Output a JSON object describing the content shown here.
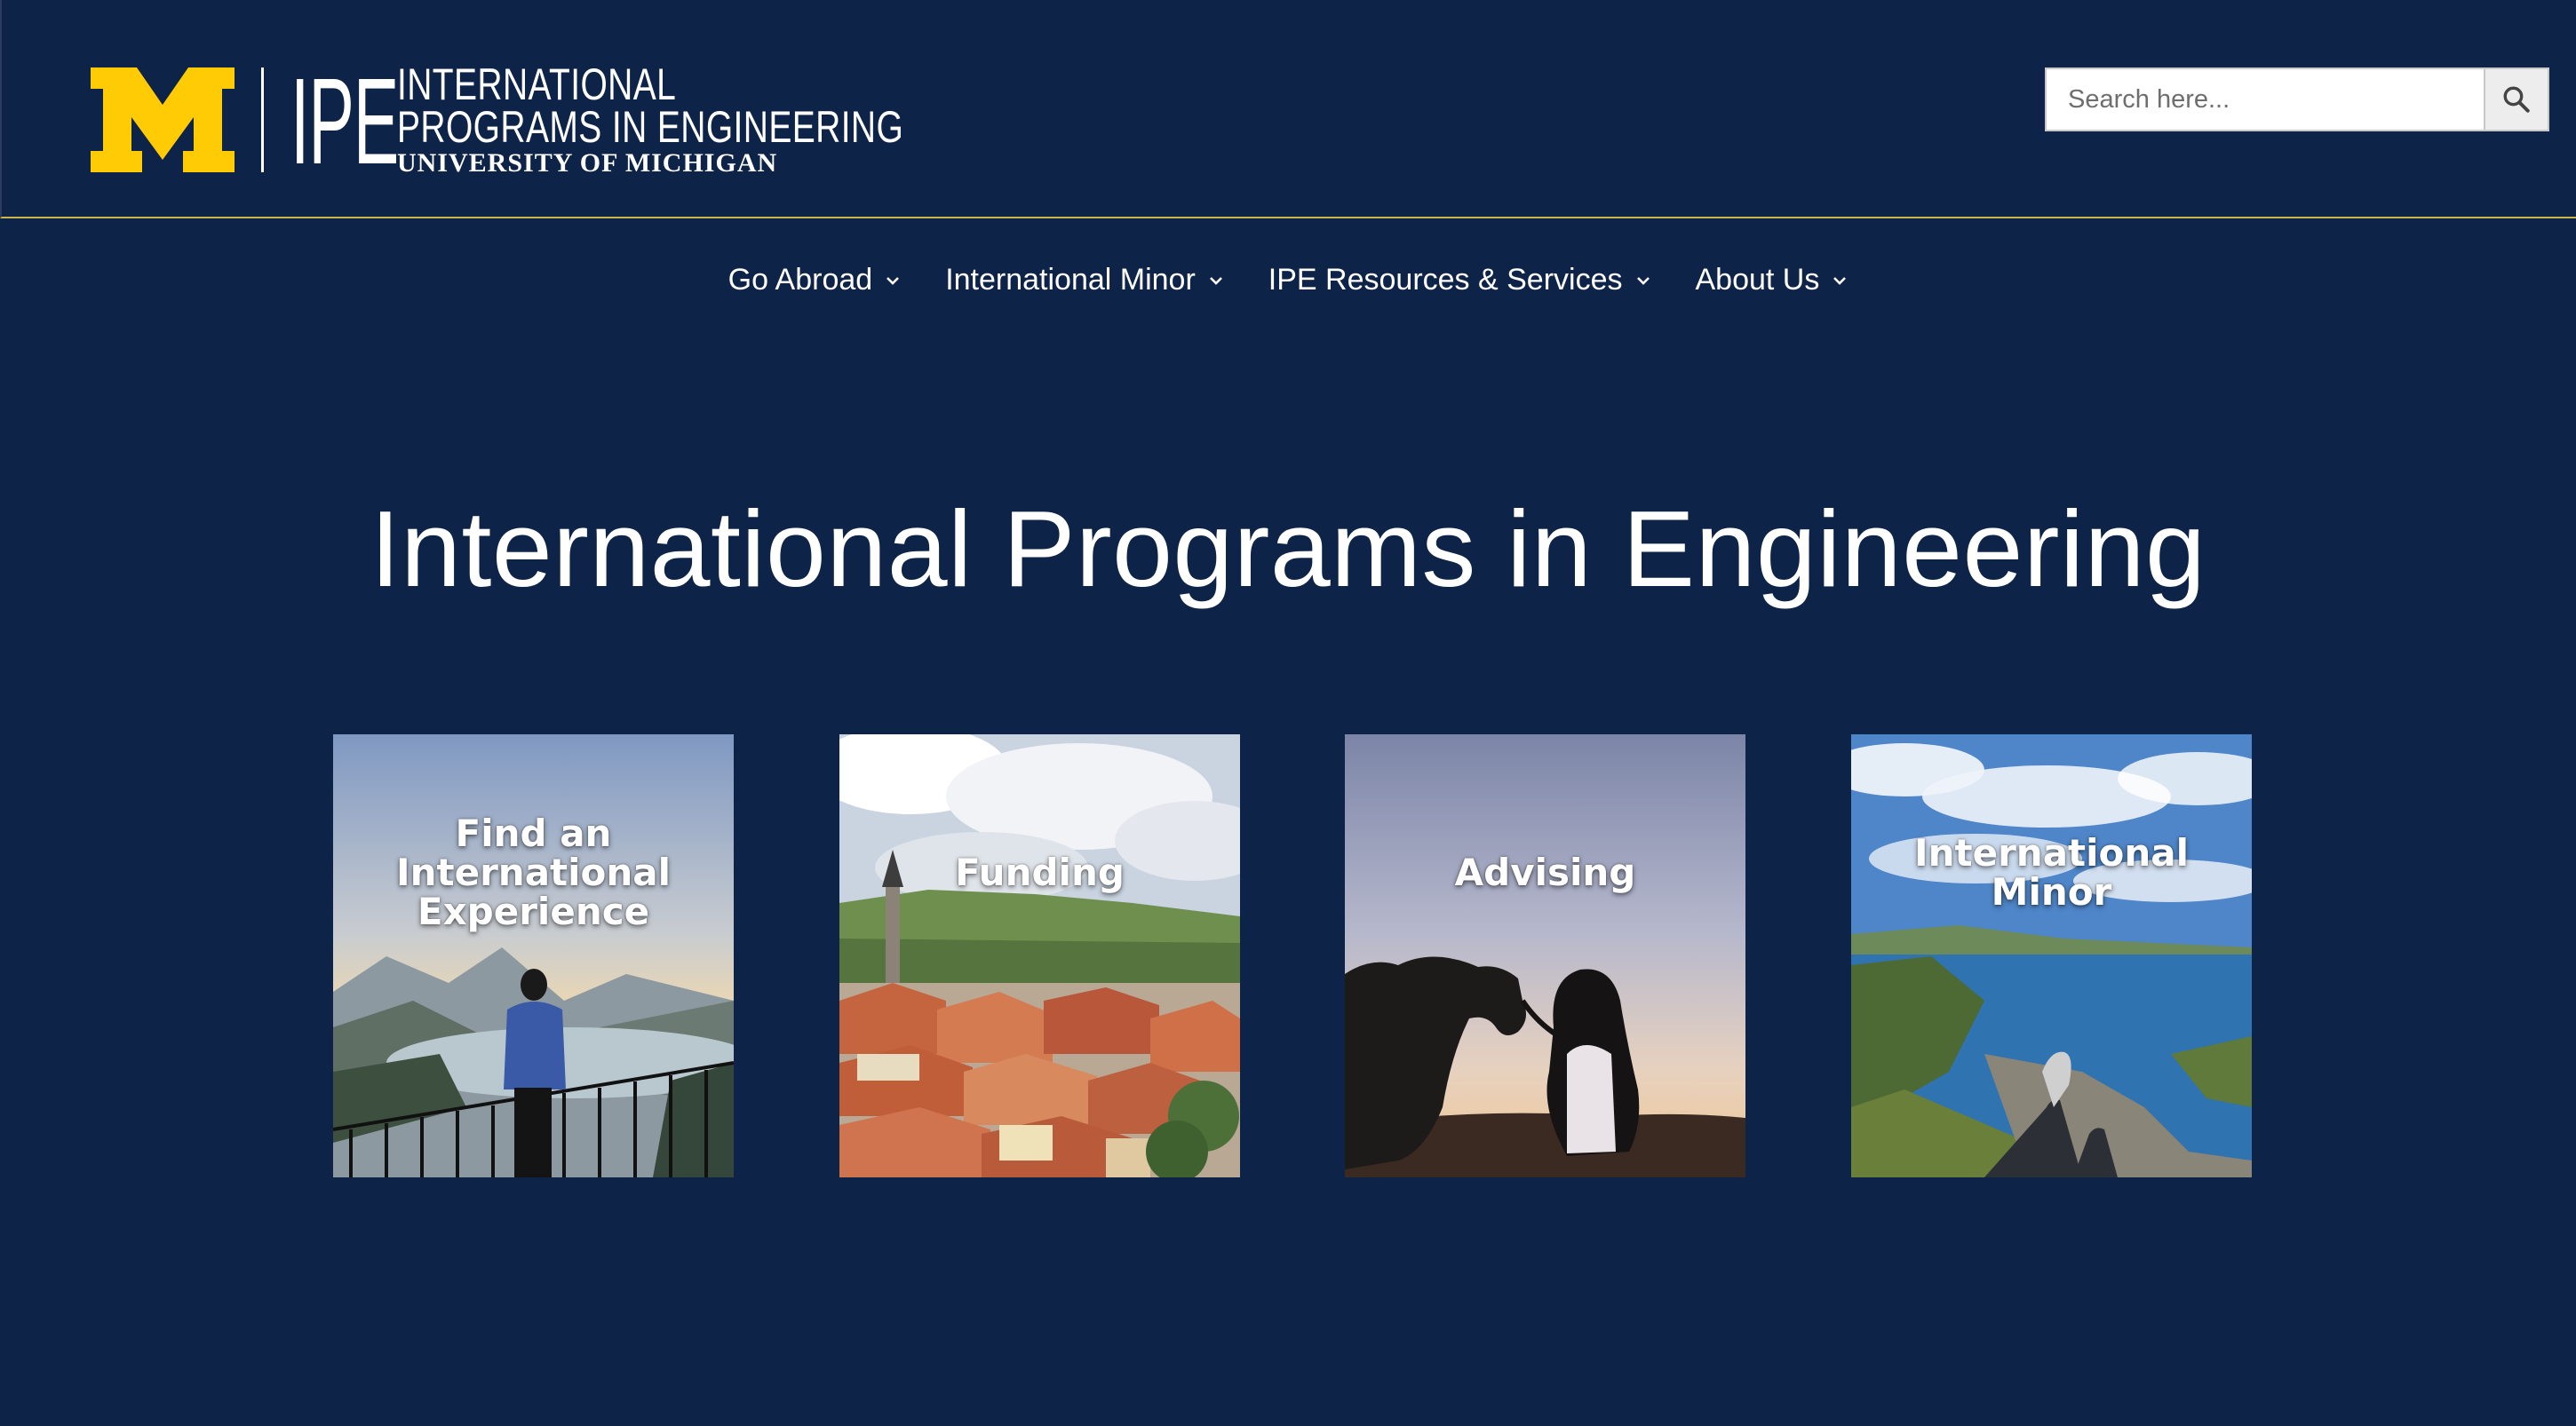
{
  "logo": {
    "mark": "IPE",
    "line1": "INTERNATIONAL",
    "line2": "PROGRAMS IN ENGINEERING",
    "line3": "UNIVERSITY OF MICHIGAN",
    "maize_color": "#FFCB05"
  },
  "search": {
    "placeholder": "Search here...",
    "value": "",
    "icon": "search-icon"
  },
  "nav": {
    "items": [
      {
        "label": "Go Abroad",
        "icon": "chevron-down-icon"
      },
      {
        "label": "International Minor",
        "icon": "chevron-down-icon"
      },
      {
        "label": "IPE Resources & Services",
        "icon": "chevron-down-icon"
      },
      {
        "label": "About Us",
        "icon": "chevron-down-icon"
      }
    ]
  },
  "hero": {
    "title": "International Programs in Engineering"
  },
  "cards": [
    {
      "label": "Find an International Experience",
      "image": "person at mountain lake overlook"
    },
    {
      "label": "Funding",
      "image": "old town red rooftops"
    },
    {
      "label": "Advising",
      "image": "woman with camel silhouette at sunset"
    },
    {
      "label": "International Minor",
      "image": "coastal cliffs with feet in foreground"
    }
  ],
  "colors": {
    "background": "#0e2348",
    "accent_line": "#c9b64a",
    "text": "#ffffff"
  }
}
